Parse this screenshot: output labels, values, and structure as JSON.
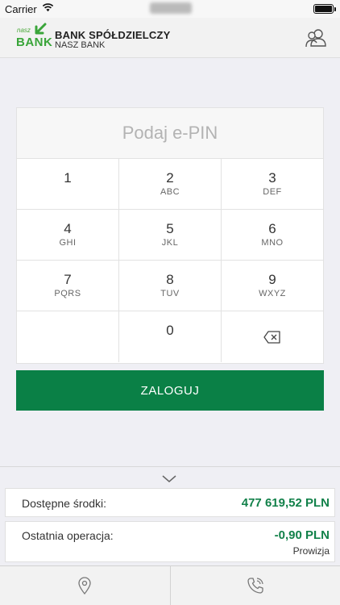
{
  "status_bar": {
    "carrier": "Carrier"
  },
  "header": {
    "bank_name": "BANK SPÓŁDZIELCZY",
    "bank_subtitle": "NASZ BANK",
    "logo_small": "nasz",
    "logo_big": "BANK"
  },
  "pin": {
    "placeholder": "Podaj e-PIN",
    "keys": [
      {
        "digit": "1",
        "letters": ""
      },
      {
        "digit": "2",
        "letters": "ABC"
      },
      {
        "digit": "3",
        "letters": "DEF"
      },
      {
        "digit": "4",
        "letters": "GHI"
      },
      {
        "digit": "5",
        "letters": "JKL"
      },
      {
        "digit": "6",
        "letters": "MNO"
      },
      {
        "digit": "7",
        "letters": "PQRS"
      },
      {
        "digit": "8",
        "letters": "TUV"
      },
      {
        "digit": "9",
        "letters": "WXYZ"
      },
      {
        "digit": "0",
        "letters": ""
      }
    ]
  },
  "login_label": "ZALOGUJ",
  "summary": {
    "available_label": "Dostępne środki:",
    "available_amount": "477 619,52 PLN",
    "last_op_label": "Ostatnia operacja:",
    "last_op_amount": "-0,90 PLN",
    "last_op_desc": "Prowizja"
  },
  "icons": {
    "users": "users-icon",
    "backspace": "backspace-icon",
    "chevron": "chevron-down-icon",
    "location": "location-pin-icon",
    "phone": "phone-call-icon"
  },
  "colors": {
    "accent": "#0a8046",
    "amount": "#12814a",
    "logo": "#3aa53a"
  }
}
